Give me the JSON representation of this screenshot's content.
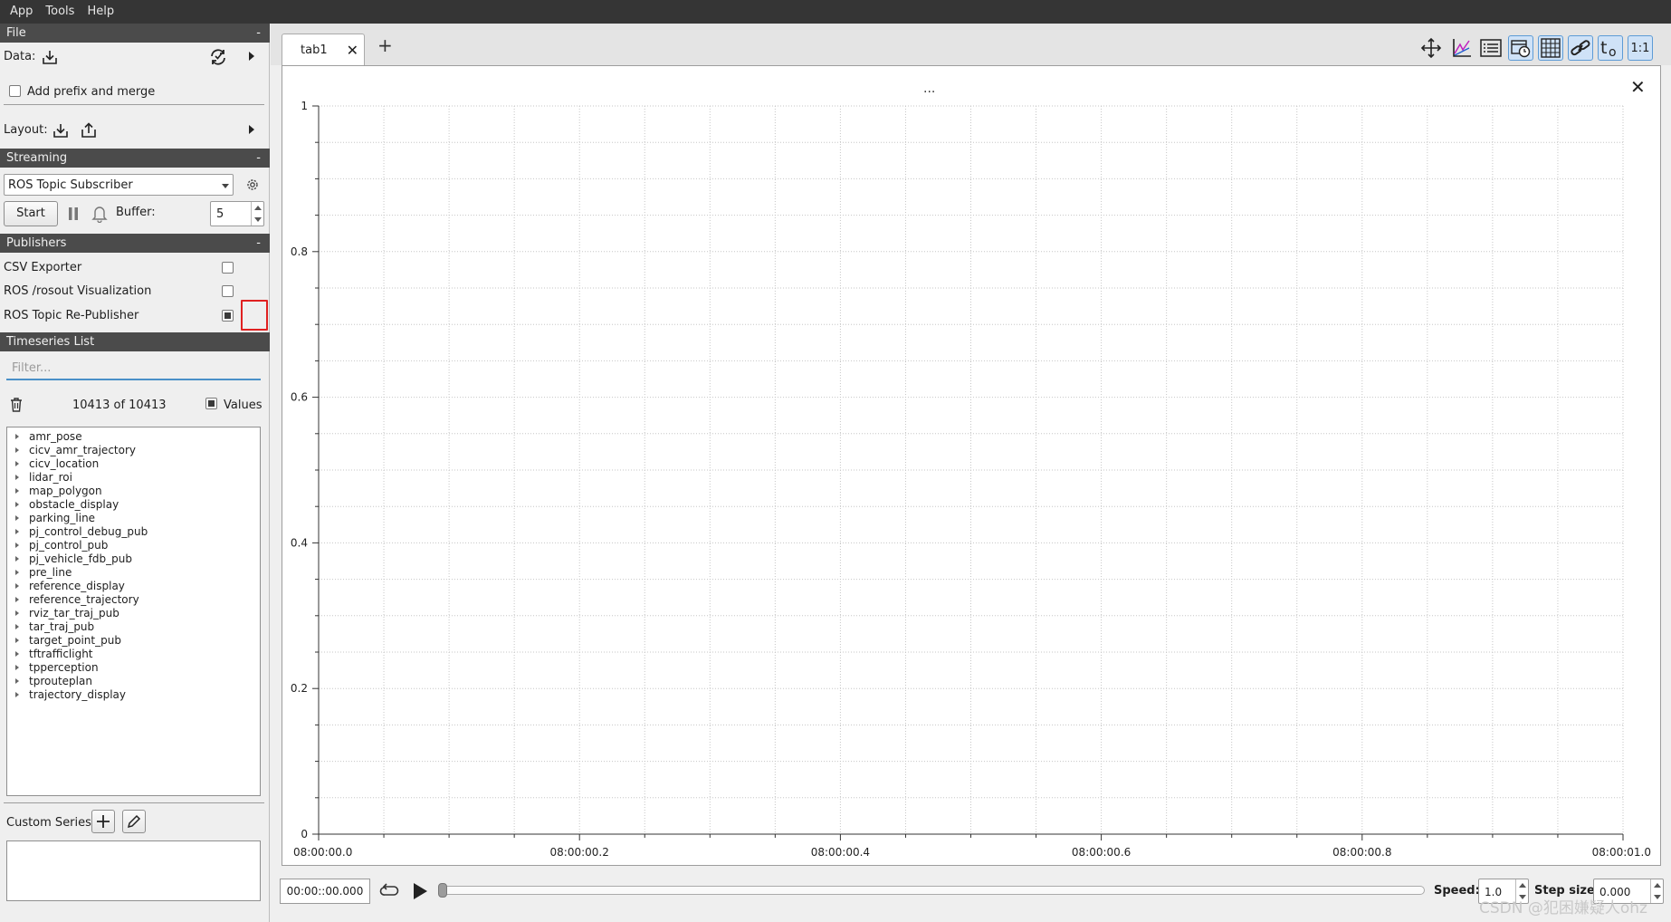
{
  "menubar": {
    "items": [
      "App",
      "Tools",
      "Help"
    ]
  },
  "file_section": {
    "header": "File",
    "collapse": "-",
    "data_label": "Data:",
    "add_prefix_label": "Add prefix and merge",
    "layout_label": "Layout:"
  },
  "streaming_section": {
    "header": "Streaming",
    "collapse": "-",
    "plugin_selected": "ROS Topic Subscriber",
    "start_label": "Start",
    "buffer_label": "Buffer:",
    "buffer_value": "5"
  },
  "publishers_section": {
    "header": "Publishers",
    "collapse": "-",
    "items": [
      {
        "label": "CSV Exporter",
        "checked": false
      },
      {
        "label": "ROS /rosout Visualization",
        "checked": false
      },
      {
        "label": "ROS Topic Re-Publisher",
        "checked": true
      }
    ]
  },
  "timeseries_section": {
    "header": "Timeseries List",
    "filter_placeholder": "Filter...",
    "count_text": "10413 of 10413",
    "values_label": "Values",
    "items": [
      "amr_pose",
      "cicv_amr_trajectory",
      "cicv_location",
      "lidar_roi",
      "map_polygon",
      "obstacle_display",
      "parking_line",
      "pj_control_debug_pub",
      "pj_control_pub",
      "pj_vehicle_fdb_pub",
      "pre_line",
      "reference_display",
      "reference_trajectory",
      "rviz_tar_traj_pub",
      "tar_traj_pub",
      "target_point_pub",
      "tftrafficlight",
      "tpperception",
      "tprouteplan",
      "trajectory_display"
    ],
    "custom_series_label": "Custom Series:"
  },
  "tabs": {
    "items": [
      {
        "label": "tab1",
        "close": "✕"
      }
    ],
    "add": "+"
  },
  "toolbar": {
    "ratio_label": "1:1",
    "t0_label": "t0"
  },
  "plot": {
    "title": "...",
    "close": "✕"
  },
  "chart_data": {
    "type": "line",
    "series": [],
    "ylim": [
      0,
      1
    ],
    "xlim": [
      0,
      1
    ],
    "y_ticks": [
      "0",
      "0.2",
      "0.4",
      "0.6",
      "0.8",
      "1"
    ],
    "x_ticks": [
      "08:00:00.0",
      "08:00:00.2",
      "08:00:00.4",
      "08:00:00.6",
      "08:00:00.8",
      "08:00:01.0"
    ],
    "grid": true
  },
  "playback": {
    "time_value": "00:00::00.000",
    "speed_label": "Speed:",
    "speed_value": "1.0",
    "step_label": "Step size:",
    "step_value": "0.000"
  },
  "watermark": "CSDN @犯困嫌疑人ohz"
}
